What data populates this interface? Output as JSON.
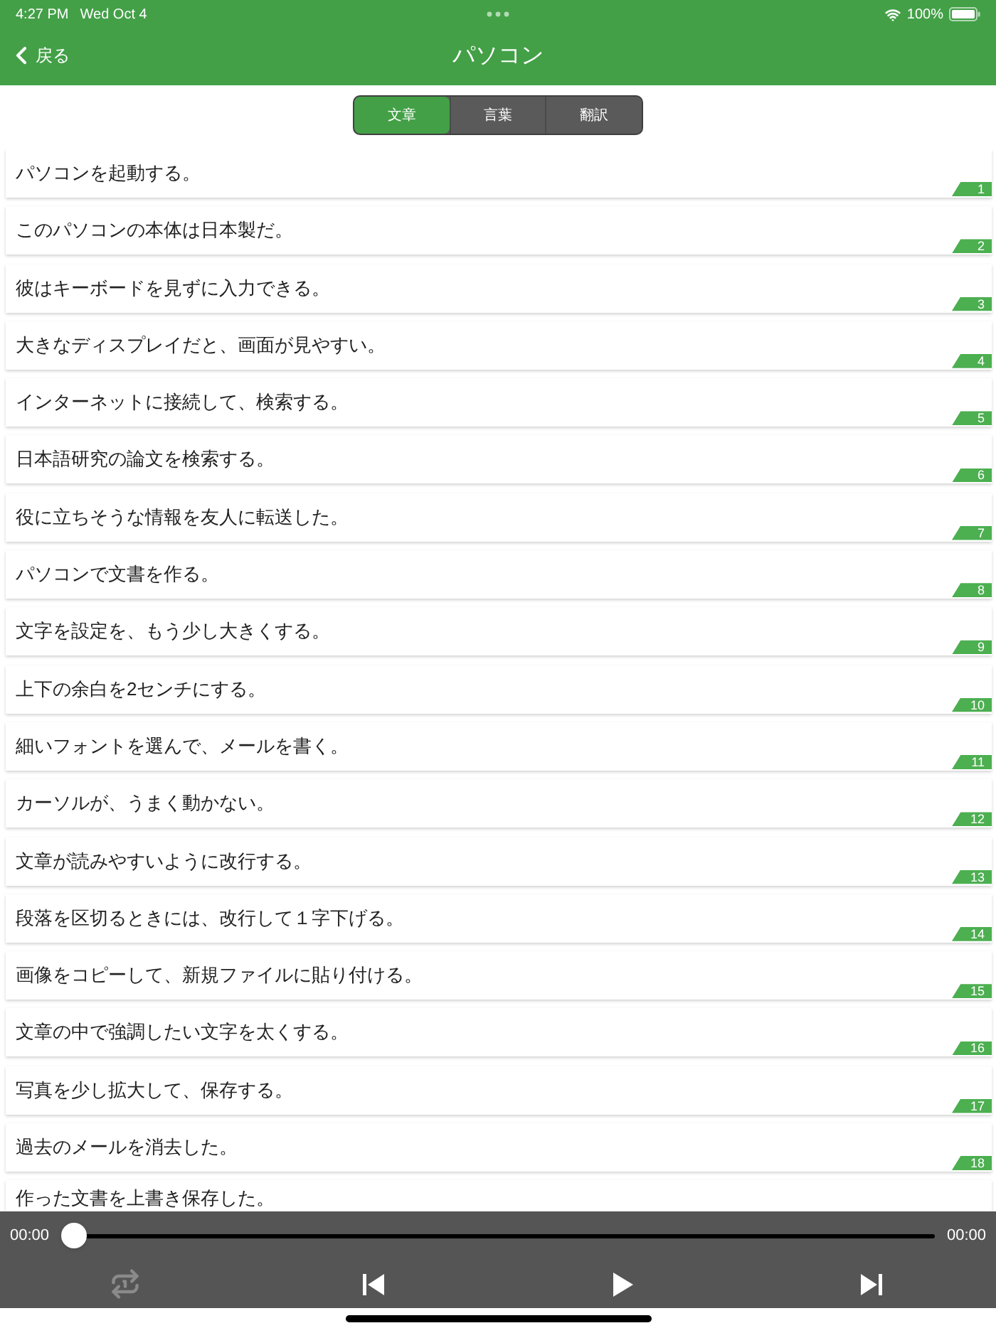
{
  "status_bar": {
    "time": "4:27 PM",
    "date": "Wed Oct 4",
    "battery": "100%"
  },
  "nav": {
    "back": "戻る",
    "title": "パソコン"
  },
  "tabs": [
    {
      "label": "文章",
      "selected": true
    },
    {
      "label": "言葉",
      "selected": false
    },
    {
      "label": "翻訳",
      "selected": false
    }
  ],
  "sentences": [
    {
      "text": "パソコンを起動する。",
      "number": "1"
    },
    {
      "text": "このパソコンの本体は日本製だ。",
      "number": "2"
    },
    {
      "text": "彼はキーボードを見ずに入力できる。",
      "number": "3"
    },
    {
      "text": "大きなディスプレイだと、画面が見やすい。",
      "number": "4"
    },
    {
      "text": "インターネットに接続して、検索する。",
      "number": "5"
    },
    {
      "text": "日本語研究の論文を検索する。",
      "number": "6"
    },
    {
      "text": "役に立ちそうな情報を友人に転送した。",
      "number": "7"
    },
    {
      "text": "パソコンで文書を作る。",
      "number": "8"
    },
    {
      "text": "文字を設定を、もう少し大きくする。",
      "number": "9"
    },
    {
      "text": "上下の余白を2センチにする。",
      "number": "10"
    },
    {
      "text": "細いフォントを選んで、メールを書く。",
      "number": "11"
    },
    {
      "text": "カーソルが、うまく動かない。",
      "number": "12"
    },
    {
      "text": "文章が読みやすいように改行する。",
      "number": "13"
    },
    {
      "text": "段落を区切るときには、改行して１字下げる。",
      "number": "14"
    },
    {
      "text": "画像をコピーして、新規ファイルに貼り付ける。",
      "number": "15"
    },
    {
      "text": "文章の中で強調したい文字を太くする。",
      "number": "16"
    },
    {
      "text": "写真を少し拡大して、保存する。",
      "number": "17"
    },
    {
      "text": "過去のメールを消去した。",
      "number": "18"
    },
    {
      "text": "作った文書を上書き保存した。"
    }
  ],
  "player": {
    "elapsed": "00:00",
    "total": "00:00",
    "level": 0,
    "repeat_one": false
  }
}
